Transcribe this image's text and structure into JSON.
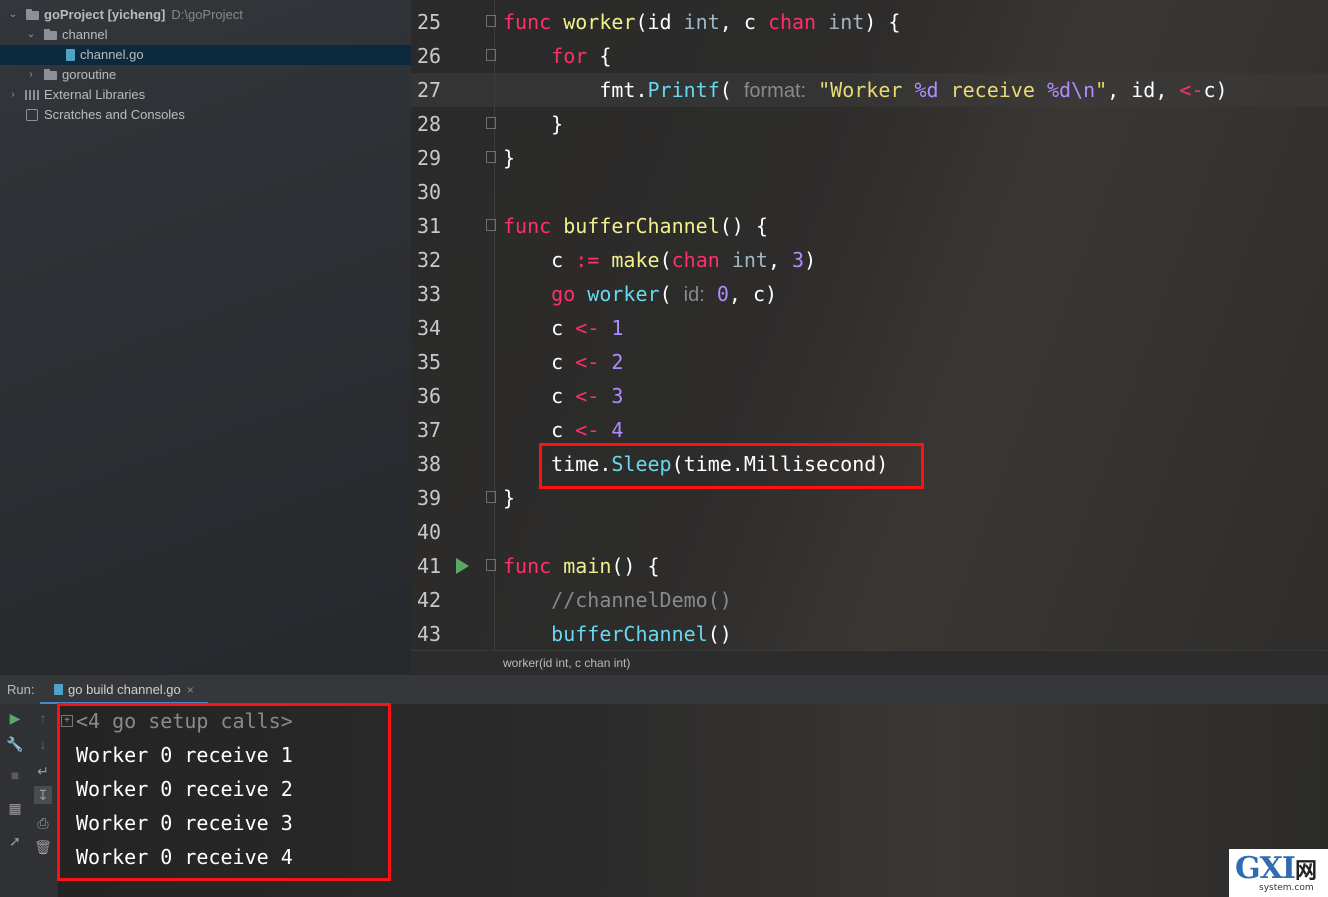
{
  "project_tree": {
    "root": {
      "name": "goProject [yicheng]",
      "path": "D:\\goProject"
    },
    "items": [
      {
        "label": "channel"
      },
      {
        "label": "channel.go"
      },
      {
        "label": "goroutine"
      },
      {
        "label": "External Libraries"
      },
      {
        "label": "Scratches and Consoles"
      }
    ]
  },
  "editor": {
    "lines": [
      {
        "n": "25",
        "tokens": [
          [
            "kw",
            "func"
          ],
          [
            "",
            ""
          ],
          [
            "fn",
            " worker"
          ],
          [
            "",
            "(id "
          ],
          [
            "typ",
            "int"
          ],
          [
            "",
            ", c "
          ],
          [
            "kw",
            "chan"
          ],
          [
            "typ",
            " int"
          ],
          [
            "",
            ") {"
          ]
        ]
      },
      {
        "n": "26",
        "tokens": [
          [
            "",
            "    "
          ],
          [
            "kw",
            "for"
          ],
          [
            "",
            " {"
          ]
        ]
      },
      {
        "n": "27",
        "tokens": [
          [
            "",
            "        fmt."
          ],
          [
            "call",
            "Printf"
          ],
          [
            "",
            "( "
          ],
          [
            "hint",
            "format:"
          ],
          [
            "",
            " "
          ],
          [
            "str",
            "\"Worker "
          ],
          [
            "esc",
            "%d"
          ],
          [
            "str",
            " receive "
          ],
          [
            "esc",
            "%d"
          ],
          [
            "esc",
            "\\n"
          ],
          [
            "str",
            "\""
          ],
          [
            "",
            ", id, "
          ],
          [
            "op",
            "<-"
          ],
          [
            "",
            "c)"
          ]
        ]
      },
      {
        "n": "28",
        "tokens": [
          [
            "",
            "    }"
          ]
        ]
      },
      {
        "n": "29",
        "tokens": [
          [
            "",
            "}"
          ]
        ]
      },
      {
        "n": "30",
        "tokens": []
      },
      {
        "n": "31",
        "tokens": [
          [
            "kw",
            "func"
          ],
          [
            "fn",
            " bufferChannel"
          ],
          [
            "",
            "() {"
          ]
        ]
      },
      {
        "n": "32",
        "tokens": [
          [
            "",
            "    c "
          ],
          [
            "op",
            ":="
          ],
          [
            "",
            " "
          ],
          [
            "fn",
            "make"
          ],
          [
            "",
            "("
          ],
          [
            "kw",
            "chan"
          ],
          [
            "typ",
            " int"
          ],
          [
            "",
            ", "
          ],
          [
            "num",
            "3"
          ],
          [
            "",
            ")"
          ]
        ]
      },
      {
        "n": "33",
        "tokens": [
          [
            "",
            "    "
          ],
          [
            "kw",
            "go"
          ],
          [
            "call",
            " worker"
          ],
          [
            "",
            "( "
          ],
          [
            "hint",
            "id:"
          ],
          [
            "",
            " "
          ],
          [
            "num",
            "0"
          ],
          [
            "",
            ", c)"
          ]
        ]
      },
      {
        "n": "34",
        "tokens": [
          [
            "",
            "    c "
          ],
          [
            "op",
            "<-"
          ],
          [
            "",
            " "
          ],
          [
            "num",
            "1"
          ]
        ]
      },
      {
        "n": "35",
        "tokens": [
          [
            "",
            "    c "
          ],
          [
            "op",
            "<-"
          ],
          [
            "",
            " "
          ],
          [
            "num",
            "2"
          ]
        ]
      },
      {
        "n": "36",
        "tokens": [
          [
            "",
            "    c "
          ],
          [
            "op",
            "<-"
          ],
          [
            "",
            " "
          ],
          [
            "num",
            "3"
          ]
        ]
      },
      {
        "n": "37",
        "tokens": [
          [
            "",
            "    c "
          ],
          [
            "op",
            "<-"
          ],
          [
            "",
            " "
          ],
          [
            "num",
            "4"
          ]
        ]
      },
      {
        "n": "38",
        "tokens": [
          [
            "",
            "    time."
          ],
          [
            "call",
            "Sleep"
          ],
          [
            "",
            "(time.Millisecond)"
          ]
        ]
      },
      {
        "n": "39",
        "tokens": [
          [
            "",
            "}"
          ]
        ]
      },
      {
        "n": "40",
        "tokens": []
      },
      {
        "n": "41",
        "tokens": [
          [
            "kw",
            "func"
          ],
          [
            "fn",
            " main"
          ],
          [
            "",
            "() {"
          ]
        ]
      },
      {
        "n": "42",
        "tokens": [
          [
            "cmt",
            "    //channelDemo()"
          ]
        ]
      },
      {
        "n": "43",
        "tokens": [
          [
            "call",
            "    bufferChannel"
          ],
          [
            "",
            "()"
          ]
        ]
      }
    ],
    "breadcrumb": "worker(id int, c chan int)"
  },
  "run_panel": {
    "label": "Run:",
    "tab": "go build channel.go",
    "close": "×",
    "setup_calls": "<4 go setup calls>",
    "output": [
      "Worker 0 receive 1",
      "Worker 0 receive 2",
      "Worker 0 receive 3",
      "Worker 0 receive 4"
    ]
  },
  "watermark": {
    "logo": "GXI",
    "cn": "网",
    "site": "system.com"
  },
  "colors": {
    "highlight_box": "#ff1111",
    "selection": "#0d293e",
    "run_icon": "#59a869"
  }
}
